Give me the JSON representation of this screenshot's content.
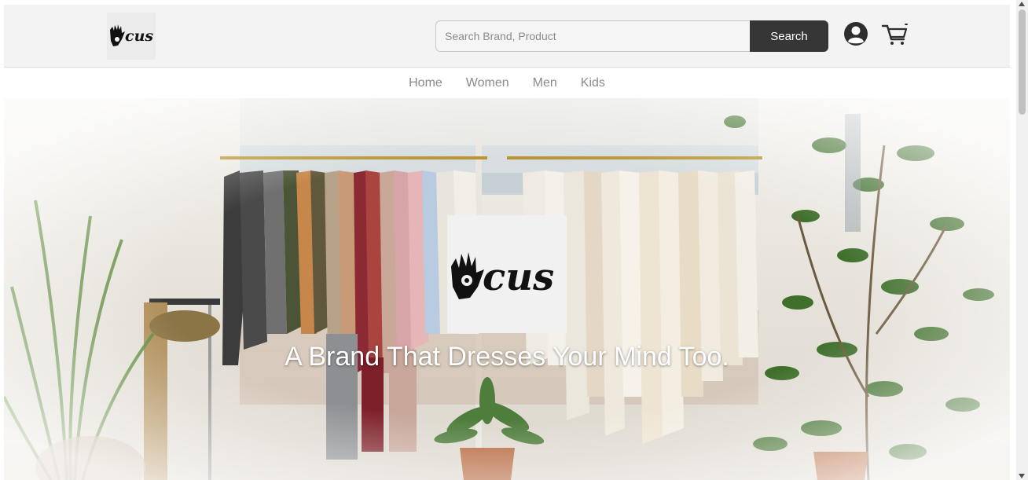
{
  "header": {
    "logo_name": "ucus-logo",
    "search": {
      "placeholder": "Search Brand, Product",
      "value": "",
      "button_label": "Search"
    },
    "icons": [
      "user-account-icon",
      "shopping-cart-icon"
    ]
  },
  "nav": {
    "items": [
      {
        "label": "Home"
      },
      {
        "label": "Women"
      },
      {
        "label": "Men"
      },
      {
        "label": "Kids"
      }
    ]
  },
  "hero": {
    "tagline": "A Brand That Dresses Your Mind Too.",
    "logo_name": "ucus-logo",
    "background": "clothing-rack-photo"
  },
  "colors": {
    "header_bg": "#f3f3f3",
    "search_button": "#363636",
    "nav_text": "#8a8a8a",
    "tagline_text": "#ffffff"
  }
}
